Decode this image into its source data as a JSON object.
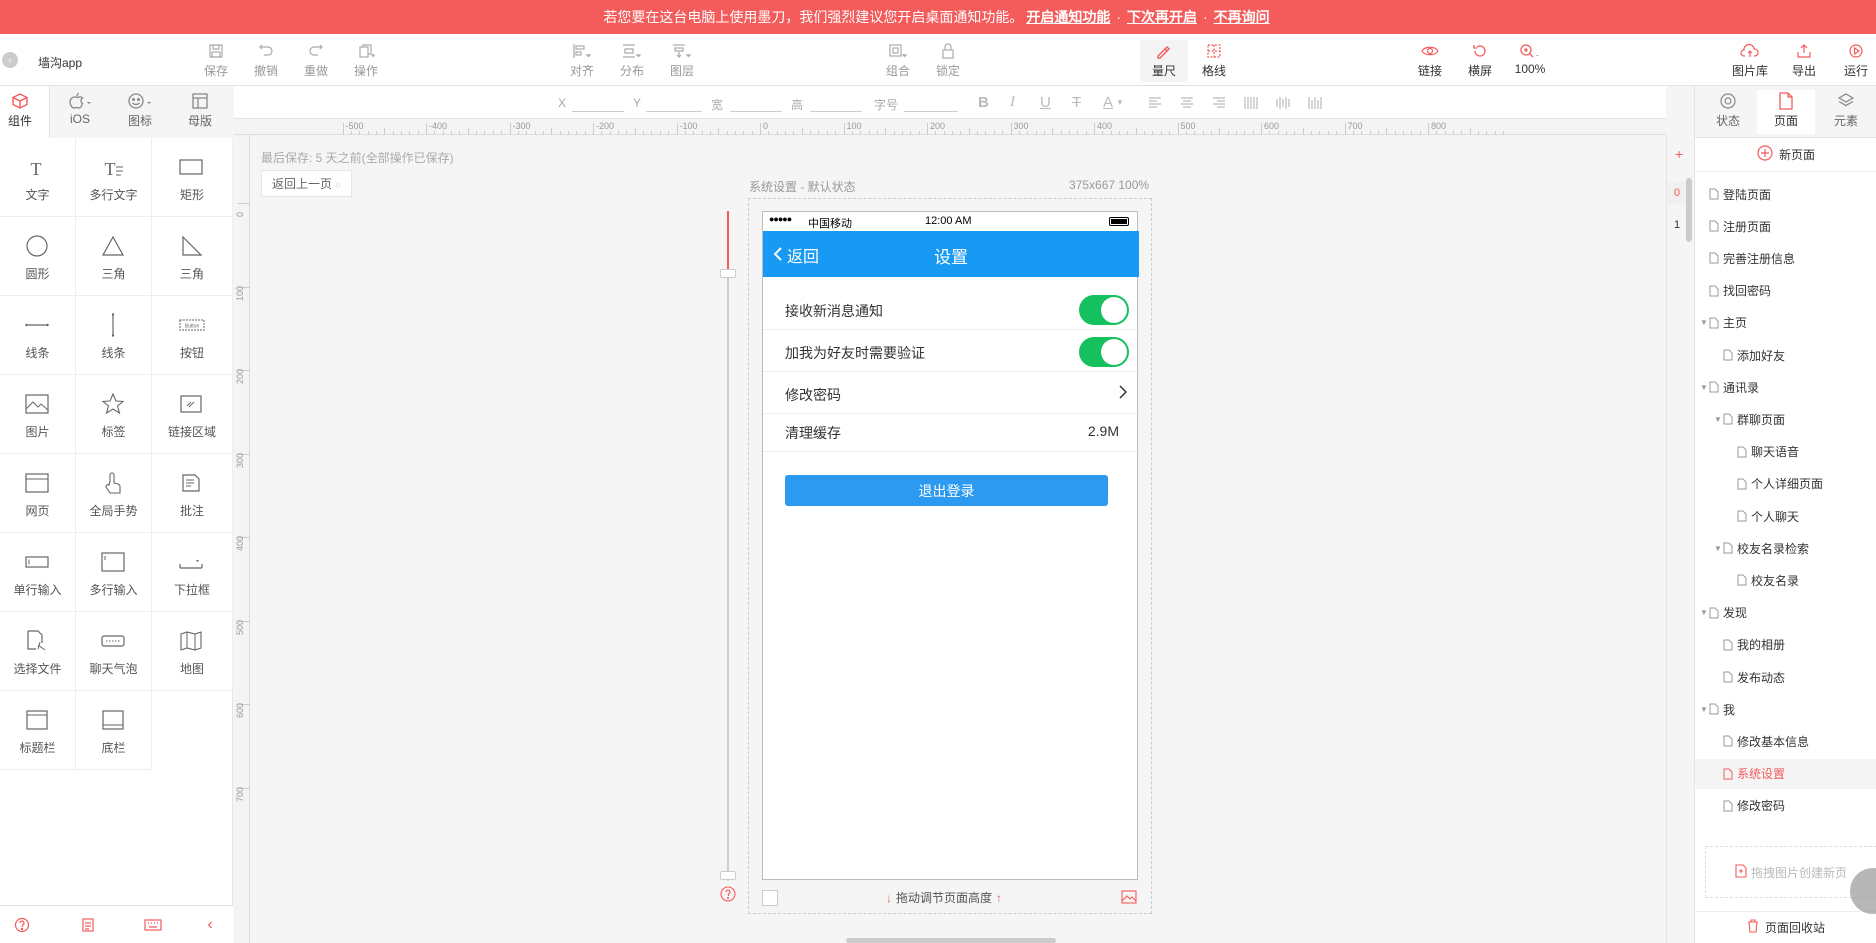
{
  "notice": {
    "message": "若您要在这台电脑上使用墨刀，我们强烈建议您开启桌面通知功能。",
    "enable": "开启通知功能",
    "later": "下次再开启",
    "never": "不再询问",
    "sep": "·"
  },
  "toolbar": {
    "project_name": "墙沟app",
    "save": "保存",
    "undo": "撤销",
    "redo": "重做",
    "operate": "操作",
    "align": "对齐",
    "distribute": "分布",
    "layer": "图层",
    "group": "组合",
    "lock": "锁定",
    "measure": "量尺",
    "gridlines": "格线",
    "link": "链接",
    "landscape": "横屏",
    "zoom": "100%",
    "library": "图片库",
    "export": "导出",
    "run": "运行"
  },
  "format": {
    "x": "X",
    "y": "Y",
    "w": "宽",
    "h": "高",
    "fontsize": "字号",
    "bold": "B",
    "italic": "I",
    "underline": "U",
    "strike": "T",
    "color": "A"
  },
  "left": {
    "tabs": [
      "组件",
      "iOS",
      "图标",
      "母版"
    ],
    "components": [
      "文字",
      "多行文字",
      "矩形",
      "圆形",
      "三角",
      "三角",
      "线条",
      "线条",
      "按钮",
      "图片",
      "标签",
      "链接区域",
      "网页",
      "全局手势",
      "批注",
      "单行输入",
      "多行输入",
      "下拉框",
      "选择文件",
      "聊天气泡",
      "地图",
      "标题栏",
      "底栏"
    ]
  },
  "ruler": {
    "h": [
      "-500",
      "-400",
      "-300",
      "-200",
      "-100",
      "0",
      "100",
      "200",
      "300",
      "400",
      "500",
      "600",
      "700",
      "800"
    ],
    "v": [
      "0",
      "100",
      "200",
      "300",
      "400",
      "500",
      "600",
      "700"
    ]
  },
  "canvas": {
    "last_saved": "最后保存: 5 天之前(全部操作已保存)",
    "back": "返回上一页",
    "page_state": "系统设置 - 默认状态",
    "size": "375x667 100%",
    "drag_height": "拖动调节页面高度"
  },
  "phone": {
    "carrier": "中国移动",
    "time": "12:00 AM",
    "back": "返回",
    "title": "设置",
    "rows": [
      {
        "label": "接收新消息通知",
        "on": true
      },
      {
        "label": "加我为好友时需要验证",
        "on": true
      }
    ],
    "change_pw": "修改密码",
    "cache": "清理缓存",
    "cache_size": "2.9M",
    "logout": "退出登录"
  },
  "right": {
    "tabs": [
      "状态",
      "页面",
      "元素"
    ],
    "new_page": "新页面",
    "pages": [
      {
        "label": "登陆页面",
        "level": 0,
        "arrow": false
      },
      {
        "label": "注册页面",
        "level": 0,
        "arrow": false
      },
      {
        "label": "完善注册信息",
        "level": 0,
        "arrow": false
      },
      {
        "label": "找回密码",
        "level": 0,
        "arrow": false
      },
      {
        "label": "主页",
        "level": 0,
        "arrow": true
      },
      {
        "label": "添加好友",
        "level": 1,
        "arrow": false
      },
      {
        "label": "通讯录",
        "level": 0,
        "arrow": true
      },
      {
        "label": "群聊页面",
        "level": 1,
        "arrow": true
      },
      {
        "label": "聊天语音",
        "level": 2,
        "arrow": false
      },
      {
        "label": "个人详细页面",
        "level": 2,
        "arrow": false
      },
      {
        "label": "个人聊天",
        "level": 2,
        "arrow": false
      },
      {
        "label": "校友名录检索",
        "level": 1,
        "arrow": true
      },
      {
        "label": "校友名录",
        "level": 2,
        "arrow": false
      },
      {
        "label": "发现",
        "level": 0,
        "arrow": true
      },
      {
        "label": "我的相册",
        "level": 1,
        "arrow": false
      },
      {
        "label": "发布动态",
        "level": 1,
        "arrow": false
      },
      {
        "label": "我",
        "level": 0,
        "arrow": true
      },
      {
        "label": "修改基本信息",
        "level": 1,
        "arrow": false
      },
      {
        "label": "系统设置",
        "level": 1,
        "arrow": false,
        "active": true
      },
      {
        "label": "修改密码",
        "level": 1,
        "arrow": false
      }
    ],
    "drop": "拖拽图片创建新页",
    "recycle": "页面回收站",
    "state_numbers": [
      "0",
      "1"
    ]
  },
  "colors": {
    "accent": "#f45b5b",
    "phone_nav": "#189af4",
    "toggle_on": "#15c15f",
    "logout": "#2c9af0"
  }
}
